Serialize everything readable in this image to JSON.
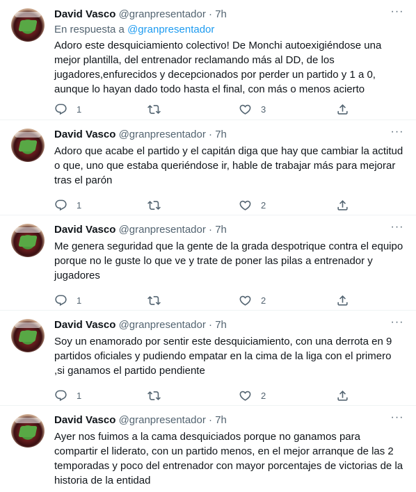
{
  "tweets": [
    {
      "name": "David Vasco",
      "handle": "@granpresentador",
      "sep": "·",
      "time": "7h",
      "reply_prefix": "En respuesta a",
      "reply_handle": "@granpresentador",
      "text": "Adoro este desquiciamiento colectivo! De Monchi autoexigiéndose una mejor plantilla, del entrenador reclamando más al DD, de los jugadores,enfurecidos y decepcionados por perder un partido y 1 a 0, aunque lo hayan dado todo hasta el final, con más o menos acierto",
      "replies": "1",
      "retweets": "",
      "likes": "3"
    },
    {
      "name": "David Vasco",
      "handle": "@granpresentador",
      "sep": "·",
      "time": "7h",
      "text": "Adoro que acabe el partido y el capitán diga que hay que cambiar la actitud o que, uno que estaba queriéndose ir, hable de trabajar más para mejorar tras el parón",
      "replies": "1",
      "retweets": "",
      "likes": "2"
    },
    {
      "name": "David Vasco",
      "handle": "@granpresentador",
      "sep": "·",
      "time": "7h",
      "text": "Me genera seguridad  que la gente de la grada despotrique contra el equipo porque no le guste lo que ve y trate de poner las pilas a entrenador y jugadores",
      "replies": "1",
      "retweets": "",
      "likes": "2"
    },
    {
      "name": "David Vasco",
      "handle": "@granpresentador",
      "sep": "·",
      "time": "7h",
      "text": "Soy un enamorado por sentir este desquiciamiento, con una derrota en 9 partidos oficiales y pudiendo empatar en la cima de la liga con el primero ,si ganamos el partido pendiente",
      "replies": "1",
      "retweets": "",
      "likes": "2"
    },
    {
      "name": "David Vasco",
      "handle": "@granpresentador",
      "sep": "·",
      "time": "7h",
      "text": "Ayer nos fuimos a la cama desquiciados porque no ganamos para compartir el liderato, con un partido menos, en el mejor arranque de las 2 temporadas y poco del entrenador con mayor porcentajes de victorias de la historia de la entidad"
    }
  ],
  "more_glyph": "···",
  "icons": {
    "reply": "reply-icon",
    "retweet": "retweet-icon",
    "like": "heart-icon",
    "share": "share-icon",
    "more": "more-icon"
  },
  "colors": {
    "text": "#0f1419",
    "secondary": "#536471",
    "link": "#1d9bf0",
    "divider": "#eff3f4"
  }
}
